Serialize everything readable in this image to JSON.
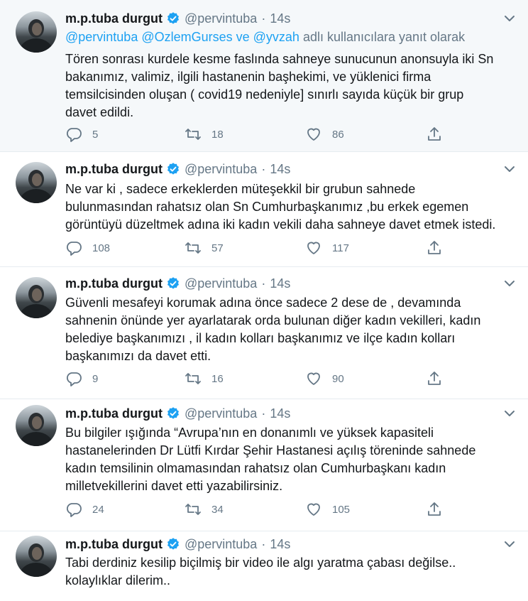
{
  "tweets": [
    {
      "name": "m.p.tuba durgut",
      "handle": "@pervintuba",
      "separator": "·",
      "time": "14s",
      "reply_to": {
        "mentions": "@pervintuba @OzlemGurses ve @yvzah",
        "suffix": "adlı kullanıcılara yanıt olarak"
      },
      "text": "Tören sonrası kurdele kesme faslında sahneye sunucunun anonsuyla iki   Sn\nbakanımız,  valimiz, ilgili hastanenin başhekimi, ve yüklenici firma\ntemsilcisinden oluşan (  covid19 nedeniyle] sınırlı sayıda küçük  bir grup\ndavet edildi.",
      "replies": "5",
      "retweets": "18",
      "likes": "86"
    },
    {
      "name": "m.p.tuba durgut",
      "handle": "@pervintuba",
      "separator": "·",
      "time": "14s",
      "text": "Ne var ki , sadece erkeklerden müteşekkil bir grubun sahnede\nbulunmasından rahatsız olan Sn Cumhurbaşkanımız ,bu erkek egemen\ngörüntüyü düzeltmek adına  iki kadın vekili daha sahneye davet etmek istedi.",
      "replies": "108",
      "retweets": "57",
      "likes": "117"
    },
    {
      "name": "m.p.tuba durgut",
      "handle": "@pervintuba",
      "separator": "·",
      "time": "14s",
      "text": "Güvenli mesafeyi korumak adına önce sadece 2 dese de , devamında\nsahnenin önünde yer ayarlatarak orda bulunan diğer kadın vekilleri, kadın\nbelediye başkanımızı , il kadın kolları başkanımız ve ilçe kadın kolları\nbaşkanımızı  da davet etti.",
      "replies": "9",
      "retweets": "16",
      "likes": "90"
    },
    {
      "name": "m.p.tuba durgut",
      "handle": "@pervintuba",
      "separator": "·",
      "time": "14s",
      "text": "Bu bilgiler ışığında “Avrupa’nın en donanımlı ve yüksek kapasiteli\nhastanelerinden Dr Lütfi  Kırdar Şehir Hastanesi açılış töreninde sahnede\nkadın temsilinin olmamasından rahatsız olan Cumhurbaşkanı kadın\nmilletvekillerini davet etti yazabilirsiniz.",
      "replies": "24",
      "retweets": "34",
      "likes": "105"
    },
    {
      "name": "m.p.tuba durgut",
      "handle": "@pervintuba",
      "separator": "·",
      "time": "14s",
      "text": "Tabi derdiniz kesilip biçilmiş bir video ile algı yaratma çabası  değilse..\nkolaylıklar dilerim.."
    }
  ],
  "icons": {
    "reply": "reply-icon",
    "retweet": "retweet-icon",
    "like": "heart-icon",
    "share": "share-icon",
    "verified": "verified-badge-icon",
    "caret": "chevron-down-icon"
  },
  "colors": {
    "accent": "#1da1f2",
    "muted": "#657786",
    "text": "#14171a",
    "highlight_bg": "#f5f8fa"
  }
}
